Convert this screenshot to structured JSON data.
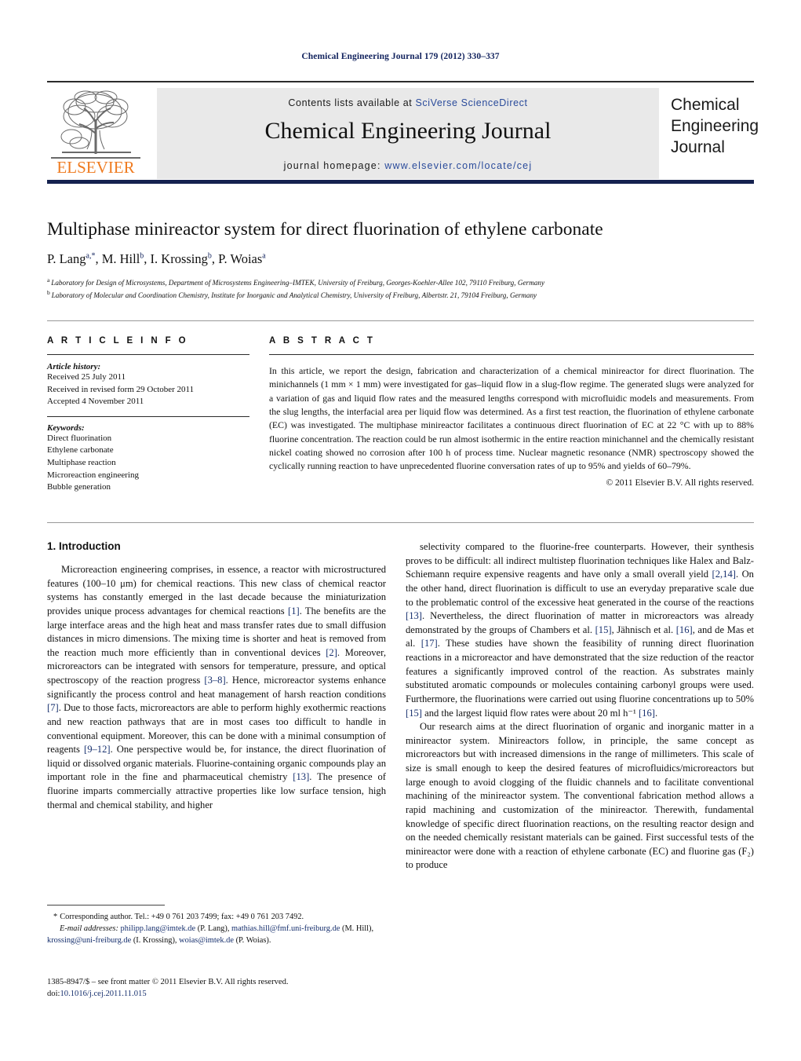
{
  "running_head": "Chemical Engineering Journal 179 (2012) 330–337",
  "masthead": {
    "contents_prefix": "Contents lists available at ",
    "sciencedirect": "SciVerse ScienceDirect",
    "journal_name": "Chemical Engineering Journal",
    "homepage_prefix": "journal homepage: ",
    "homepage_url": "www.elsevier.com/locate/cej",
    "publisher": "ELSEVIER",
    "cover_title": "Chemical Engineering Journal",
    "accent_link_color": "#2a4b9b",
    "bar_color": "#15224f",
    "publisher_color": "#ef7b20"
  },
  "title_block": {
    "title": "Multiphase minireactor system for direct fluorination of ethylene carbonate",
    "authors": [
      {
        "name": "P. Lang",
        "marks": "a,*"
      },
      {
        "name": "M. Hill",
        "marks": "b"
      },
      {
        "name": "I. Krossing",
        "marks": "b"
      },
      {
        "name": "P. Woias",
        "marks": "a"
      }
    ],
    "affiliations": [
      {
        "mark": "a",
        "text": "Laboratory for Design of Microsystems, Department of Microsystems Engineering–IMTEK, University of Freiburg, Georges-Koehler-Allee 102, 79110 Freiburg, Germany"
      },
      {
        "mark": "b",
        "text": "Laboratory of Molecular and Coordination Chemistry, Institute for Inorganic and Analytical Chemistry, University of Freiburg, Albertstr. 21, 79104 Freiburg, Germany"
      }
    ]
  },
  "article_info": {
    "heading": "A R T I C L E    I N F O",
    "history_label": "Article history:",
    "history": [
      "Received 25 July 2011",
      "Received in revised form 29 October 2011",
      "Accepted 4 November 2011"
    ],
    "keywords_label": "Keywords:",
    "keywords": [
      "Direct fluorination",
      "Ethylene carbonate",
      "Multiphase reaction",
      "Microreaction engineering",
      "Bubble generation"
    ]
  },
  "abstract": {
    "heading": "A B S T R A C T",
    "text": "In this article, we report the design, fabrication and characterization of a chemical minireactor for direct fluorination. The minichannels (1 mm × 1 mm) were investigated for gas–liquid flow in a slug-flow regime. The generated slugs were analyzed for a variation of gas and liquid flow rates and the measured lengths correspond with microfluidic models and measurements. From the slug lengths, the interfacial area per liquid flow was determined. As a first test reaction, the fluorination of ethylene carbonate (EC) was investigated. The multiphase minireactor facilitates a continuous direct fluorination of EC at 22 °C with up to 88% fluorine concentration. The reaction could be run almost isothermic in the entire reaction minichannel and the chemically resistant nickel coating showed no corrosion after 100 h of process time. Nuclear magnetic resonance (NMR) spectroscopy showed the cyclically running reaction to have unprecedented fluorine conversation rates of up to 95% and yields of 60–79%.",
    "copyright": "© 2011 Elsevier B.V. All rights reserved."
  },
  "body": {
    "section_number_title": "1.  Introduction",
    "left_paragraphs": [
      "Microreaction engineering comprises, in essence, a reactor with microstructured features (100–10 μm) for chemical reactions. This new class of chemical reactor systems has constantly emerged in the last decade because the miniaturization provides unique process advantages for chemical reactions [1]. The benefits are the large interface areas and the high heat and mass transfer rates due to small diffusion distances in micro dimensions. The mixing time is shorter and heat is removed from the reaction much more efficiently than in conventional devices [2]. Moreover, microreactors can be integrated with sensors for temperature, pressure, and optical spectroscopy of the reaction progress [3–8]. Hence, microreactor systems enhance significantly the process control and heat management of harsh reaction conditions [7]. Due to those facts, microreactors are able to perform highly exothermic reactions and new reaction pathways that are in most cases too difficult to handle in conventional equipment. Moreover, this can be done with a minimal consumption of reagents [9–12]. One perspective would be, for instance, the direct fluorination of liquid or dissolved organic materials. Fluorine-containing organic compounds play an important role in the fine and pharmaceutical chemistry [13]. The presence of fluorine imparts commercially attractive properties like low surface tension, high thermal and chemical stability, and higher"
    ],
    "right_paragraphs": [
      "selectivity compared to the fluorine-free counterparts. However, their synthesis proves to be difficult: all indirect multistep fluorination techniques like Halex and Balz-Schiemann require expensive reagents and have only a small overall yield [2,14]. On the other hand, direct fluorination is difficult to use an everyday preparative scale due to the problematic control of the excessive heat generated in the course of the reactions [13]. Nevertheless, the direct fluorination of matter in microreactors was already demonstrated by the groups of Chambers et al. [15], Jähnisch et al. [16], and de Mas et al. [17]. These studies have shown the feasibility of running direct fluorination reactions in a microreactor and have demonstrated that the size reduction of the reactor features a significantly improved control of the reaction. As substrates mainly substituted aromatic compounds or molecules containing carbonyl groups were used. Furthermore, the fluorinations were carried out using fluorine concentrations up to 50% [15] and the largest liquid flow rates were about 20 ml h⁻¹ [16].",
      "Our research aims at the direct fluorination of organic and inorganic matter in a minireactor system. Minireactors follow, in principle, the same concept as microreactors but with increased dimensions in the range of millimeters. This scale of size is small enough to keep the desired features of microfluidics/microreactors but large enough to avoid clogging of the fluidic channels and to facilitate conventional machining of the minireactor system. The conventional fabrication method allows a rapid machining and customization of the minireactor. Therewith, fundamental knowledge of specific direct fluorination reactions, on the resulting reactor design and on the needed chemically resistant materials can be gained. First successful tests of the minireactor were done with a reaction of ethylene carbonate (EC) and fluorine gas (F₂) to produce"
    ]
  },
  "footnote": {
    "corresponding": "Corresponding author. Tel.: +49 0 761 203 7499; fax: +49 0 761 203 7492.",
    "email_label": "E-mail addresses:",
    "emails": [
      {
        "address": "philipp.lang@imtek.de",
        "owner": " (P. Lang),"
      },
      {
        "address": "mathias.hill@fmf.uni-freiburg.de",
        "owner": " (M. Hill),"
      },
      {
        "address": "krossing@uni-freiburg.de",
        "owner": " (I. Krossing),"
      },
      {
        "address": "woias@imtek.de",
        "owner": " (P. Woias)."
      }
    ]
  },
  "issn": {
    "line1": "1385-8947/$ – see front matter © 2011 Elsevier B.V. All rights reserved.",
    "doi_label": "doi:",
    "doi_value": "10.1016/j.cej.2011.11.015"
  }
}
